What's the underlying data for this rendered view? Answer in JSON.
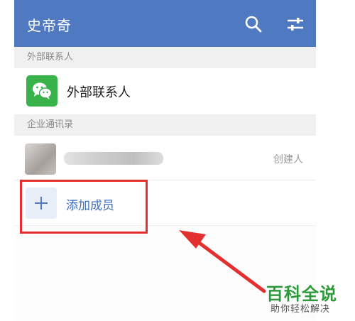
{
  "header": {
    "title": "史帝奇",
    "search_icon": "search-icon",
    "filter_icon": "sliders-icon",
    "background_color": "#4f79c1"
  },
  "external_contacts": {
    "section_label": "外部联系人",
    "item_label": "外部联系人",
    "icon": "wechat-icon",
    "icon_color": "#37b34a"
  },
  "enterprise_directory": {
    "section_label": "企业通讯录",
    "creator_tag": "创建人",
    "add_member_label": "添加成员",
    "add_icon": "plus-icon",
    "accent_color": "#3d6fc0"
  },
  "annotation": {
    "highlight_color": "#e3302f"
  },
  "watermark": {
    "brand": "百科全说",
    "tagline": "助你轻松解决",
    "brand_color": "#2d9a3a"
  }
}
